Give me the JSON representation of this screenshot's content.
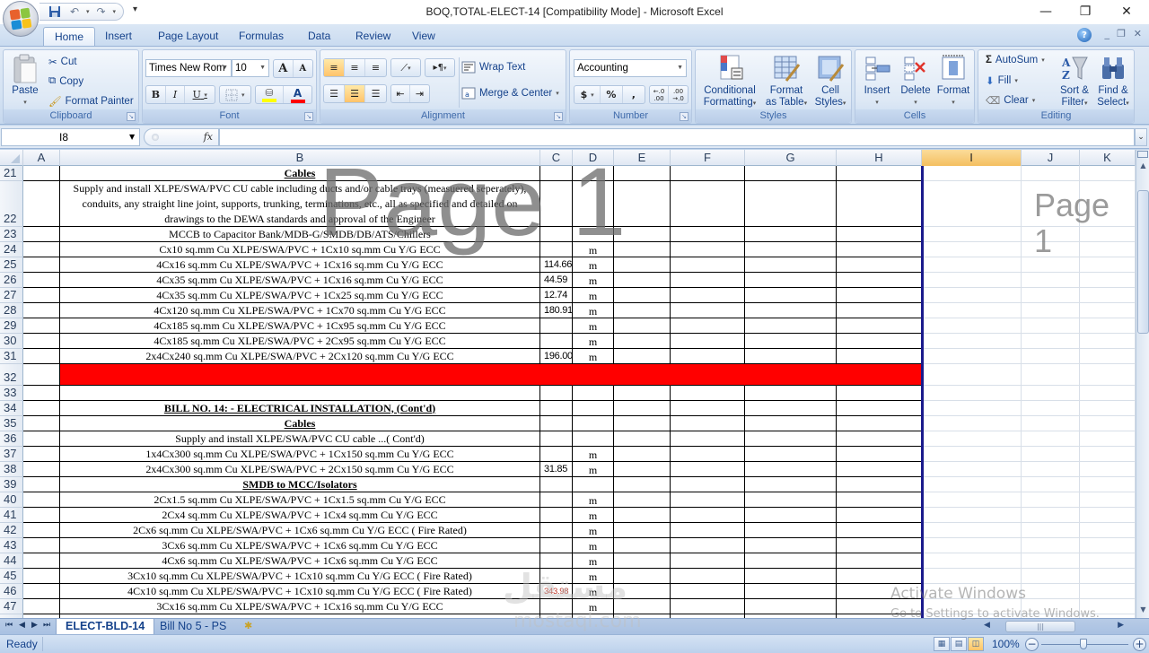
{
  "window": {
    "title": "BOQ,TOTAL-ELECT-14  [Compatibility Mode] - Microsoft Excel",
    "controls": {
      "minimize": "—",
      "restore": "❐",
      "close": "✕"
    }
  },
  "quick_access": {
    "save": "save-icon",
    "undo": "undo-icon",
    "redo": "redo-icon",
    "customize": "▾"
  },
  "ribbon": {
    "tabs": [
      {
        "label": "Home",
        "active": true
      },
      {
        "label": "Insert"
      },
      {
        "label": "Page Layout"
      },
      {
        "label": "Formulas"
      },
      {
        "label": "Data"
      },
      {
        "label": "Review"
      },
      {
        "label": "View"
      }
    ],
    "clipboard": {
      "label": "Clipboard",
      "paste": "Paste",
      "cut": "Cut",
      "copy": "Copy",
      "format_painter": "Format Painter"
    },
    "font": {
      "label": "Font",
      "font_name": "Times New Rom",
      "font_size": "10",
      "grow": "A",
      "shrink": "A",
      "bold": "B",
      "italic": "I",
      "underline": "U",
      "highlight_color": "#ffff00",
      "font_color": "#ff0000"
    },
    "alignment": {
      "label": "Alignment",
      "wrap_text": "Wrap Text",
      "merge_center": "Merge & Center"
    },
    "number": {
      "label": "Number",
      "format": "Accounting",
      "currency": "$",
      "percent": "%",
      "comma": ",",
      "inc_decimal": "←.0 .00",
      "dec_decimal": ".00 →.0"
    },
    "styles": {
      "label": "Styles",
      "conditional": [
        "Conditional",
        "Formatting"
      ],
      "format_table": [
        "Format",
        "as Table"
      ],
      "cell_styles": [
        "Cell",
        "Styles"
      ]
    },
    "cells": {
      "label": "Cells",
      "insert": "Insert",
      "delete": "Delete",
      "format": "Format"
    },
    "editing": {
      "label": "Editing",
      "autosum": "AutoSum",
      "fill": "Fill",
      "clear": "Clear",
      "sort_filter": [
        "Sort &",
        "Filter"
      ],
      "find_select": [
        "Find &",
        "Select"
      ]
    }
  },
  "formula_bar": {
    "name_box": "I8",
    "fx": "fx",
    "formula": ""
  },
  "grid": {
    "columns": [
      "A",
      "B",
      "C",
      "D",
      "E",
      "F",
      "G",
      "H",
      "I",
      "J",
      "K"
    ],
    "selected_column": "I",
    "rows": [
      {
        "num": "21",
        "b": "Cables",
        "style": "heading"
      },
      {
        "num": "22",
        "b": "Supply and install XLPE/SWA/PVC CU cable including ducts and/or cable trays (measuered seperately), conduits, any straight line joint, supports, trunking, terminations, etc., all as specified and detailed on drawings to the DEWA standards and approval of the Engineer",
        "style": "wrap"
      },
      {
        "num": "23",
        "b": "MCCB  to Capacitor Bank/MDB-G/SMDB/DB/ATS/Chillers"
      },
      {
        "num": "24",
        "b": "Cx10 sq.mm Cu XLPE/SWA/PVC + 1Cx10 sq.mm Cu Y/G ECC",
        "d": "m"
      },
      {
        "num": "25",
        "b": "4Cx16 sq.mm Cu XLPE/SWA/PVC + 1Cx16 sq.mm Cu Y/G ECC",
        "c": "114.66",
        "d": "m"
      },
      {
        "num": "26",
        "b": "4Cx35 sq.mm Cu XLPE/SWA/PVC + 1Cx16 sq.mm Cu Y/G ECC",
        "c": "44.59",
        "d": "m"
      },
      {
        "num": "27",
        "b": "4Cx35 sq.mm Cu XLPE/SWA/PVC + 1Cx25 sq.mm Cu Y/G ECC",
        "c": "12.74",
        "d": "m"
      },
      {
        "num": "28",
        "b": "4Cx120 sq.mm Cu XLPE/SWA/PVC + 1Cx70 sq.mm Cu Y/G ECC",
        "c": "180.91",
        "d": "m"
      },
      {
        "num": "29",
        "b": "4Cx185 sq.mm Cu XLPE/SWA/PVC + 1Cx95 sq.mm Cu Y/G ECC",
        "d": "m"
      },
      {
        "num": "30",
        "b": "4Cx185 sq.mm Cu XLPE/SWA/PVC + 2Cx95 sq.mm Cu Y/G ECC",
        "d": "m"
      },
      {
        "num": "31",
        "b": "2x4Cx240 sq.mm Cu XLPE/SWA/PVC + 2Cx120 sq.mm Cu Y/G ECC",
        "c": "196.00",
        "d": "m"
      },
      {
        "num": "32",
        "b": "",
        "style": "redfill",
        "fill_color": "#ff0000"
      },
      {
        "num": "33",
        "b": ""
      },
      {
        "num": "34",
        "b": "BILL NO. 14: - ELECTRICAL INSTALLATION, (Cont'd)",
        "style": "heading"
      },
      {
        "num": "35",
        "b": "Cables",
        "style": "heading"
      },
      {
        "num": "36",
        "b": "Supply and install XLPE/SWA/PVC CU cable ...( Cont'd)"
      },
      {
        "num": "37",
        "b": "1x4Cx300 sq.mm Cu XLPE/SWA/PVC + 1Cx150 sq.mm Cu Y/G ECC",
        "d": "m"
      },
      {
        "num": "38",
        "b": "2x4Cx300 sq.mm Cu XLPE/SWA/PVC + 2Cx150 sq.mm Cu Y/G ECC",
        "c": "31.85",
        "d": "m"
      },
      {
        "num": "39",
        "b": "SMDB to MCC/Isolators",
        "style": "heading"
      },
      {
        "num": "40",
        "b": "2Cx1.5 sq.mm Cu XLPE/SWA/PVC + 1Cx1.5 sq.mm Cu Y/G ECC",
        "d": "m"
      },
      {
        "num": "41",
        "b": "2Cx4 sq.mm Cu XLPE/SWA/PVC + 1Cx4 sq.mm Cu Y/G ECC",
        "d": "m"
      },
      {
        "num": "42",
        "b": "2Cx6 sq.mm Cu XLPE/SWA/PVC + 1Cx6 sq.mm Cu Y/G ECC ( Fire Rated)",
        "d": "m"
      },
      {
        "num": "43",
        "b": "3Cx6 sq.mm Cu XLPE/SWA/PVC + 1Cx6 sq.mm Cu Y/G ECC",
        "d": "m"
      },
      {
        "num": "44",
        "b": "4Cx6 sq.mm Cu XLPE/SWA/PVC + 1Cx6 sq.mm Cu Y/G ECC",
        "d": "m"
      },
      {
        "num": "45",
        "b": "3Cx10 sq.mm Cu XLPE/SWA/PVC + 1Cx10 sq.mm Cu Y/G ECC ( Fire Rated)",
        "d": "m"
      },
      {
        "num": "46",
        "b": "4Cx10 sq.mm Cu XLPE/SWA/PVC + 1Cx10 sq.mm Cu Y/G ECC ( Fire Rated)",
        "c": "343.98",
        "c_color": "red",
        "d": "m"
      },
      {
        "num": "47",
        "b": "3Cx16 sq.mm Cu XLPE/SWA/PVC + 1Cx16 sq.mm Cu Y/G ECC",
        "d": "m"
      }
    ],
    "page_watermark_large": "Page 1",
    "page_watermark_side": "Page 1"
  },
  "sheet_tabs": [
    {
      "label": "ELECT-BLD-14",
      "active": true
    },
    {
      "label": "Bill No 5 - PS"
    }
  ],
  "status_bar": {
    "status": "Ready",
    "zoom": "100%",
    "view_mode": "page-break-preview"
  },
  "overlays": {
    "activate_title": "Activate Windows",
    "activate_sub": "Go to Settings to activate Windows.",
    "site_watermark": "مستقل",
    "site_watermark_sub": "mostaql.com"
  }
}
